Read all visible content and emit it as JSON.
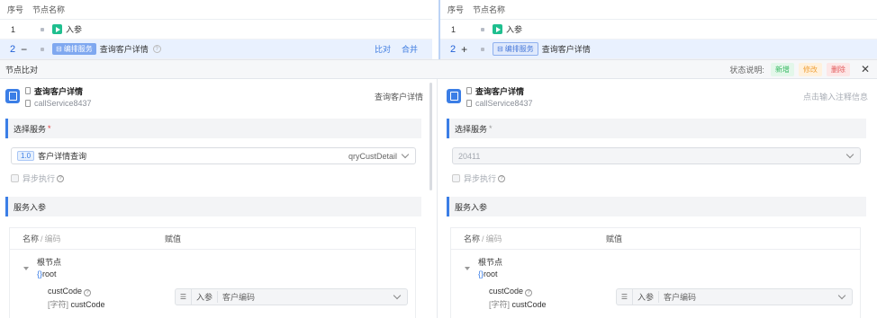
{
  "top_table": {
    "col_index": "序号",
    "col_name": "节点名称",
    "left_rows": [
      {
        "index": "1",
        "name": "入参"
      },
      {
        "index": "2",
        "tag": "编排服务",
        "name": "查询客户详情",
        "symbol": "−",
        "actions": [
          "比对",
          "合并"
        ]
      }
    ],
    "right_rows": [
      {
        "index": "1",
        "name": "入参"
      },
      {
        "index": "2",
        "tag": "编排服务",
        "name": "查询客户详情",
        "symbol": "+"
      }
    ]
  },
  "compare_bar": {
    "title": "节点比对",
    "legend_label": "状态说明:",
    "legend": {
      "add": "新增",
      "modify": "修改",
      "delete": "删除"
    },
    "close": "✕"
  },
  "left_pane": {
    "node_title": "查询客户详情",
    "node_code": "callService8437",
    "node_right": "查询客户详情",
    "section_service": "选择服务",
    "required_mark": "*",
    "service_version": "1.0",
    "service_name": "客户详情查询",
    "service_code": "qryCustDetail",
    "async_label": "异步执行",
    "section_params": "服务入参",
    "col_name": "名称",
    "col_code": "编码",
    "col_value": "赋值",
    "root_name": "根节点",
    "root_code": "root",
    "param_name": "custCode",
    "param_type": "[字符]",
    "param_code": "custCode",
    "value_source": "入参",
    "value_text": "客户编码"
  },
  "right_pane": {
    "node_title": "查询客户详情",
    "node_code": "callService8437",
    "node_placeholder": "点击输入注释信息",
    "section_service": "选择服务",
    "required_mark": "*",
    "service_value": "20411",
    "async_label": "异步执行",
    "section_params": "服务入参",
    "col_name": "名称",
    "col_code": "编码",
    "col_value": "赋值",
    "root_name": "根节点",
    "root_code": "root",
    "param_name": "custCode",
    "param_type": "[字符]",
    "param_code": "custCode",
    "value_source": "入参",
    "value_text": "客户编码"
  }
}
